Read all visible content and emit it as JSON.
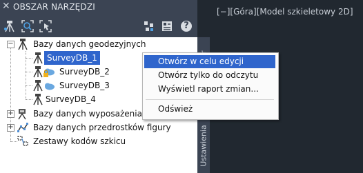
{
  "palette": {
    "title": "OBSZAR NARZĘDZI",
    "close_glyph": "✕"
  },
  "toolbar": {
    "left_icons": [
      "survey-network-icon",
      "zoom-extents-icon",
      "zoom-selection-icon"
    ],
    "right_icons": [
      "survey-preferences-icon",
      "properties-icon",
      "help-icon"
    ],
    "help_glyph": "?"
  },
  "tree": {
    "root": {
      "label": "Bazy danych geodezyjnych",
      "expander": "−"
    },
    "databases": [
      {
        "label": "SurveyDB_1",
        "selected": true,
        "locked": false
      },
      {
        "label": "SurveyDB_2",
        "selected": false,
        "locked": true
      },
      {
        "label": "SurveyDB_3",
        "selected": false,
        "locked": false
      },
      {
        "label": "SurveyDB_4",
        "selected": false,
        "locked": false
      }
    ],
    "others": [
      {
        "label": "Bazy danych wyposażenia",
        "expander": "+"
      },
      {
        "label": "Bazy danych przedrostków figury",
        "expander": "+"
      },
      {
        "label": "Zestawy kodów szkicu",
        "expander": ""
      }
    ]
  },
  "tabs": {
    "upper": "ator",
    "lower": "Ustawienia"
  },
  "viewport": {
    "label": "[−][Góra][Model szkieletowy 2D]"
  },
  "context_menu": {
    "items": [
      {
        "label": "Otwórz w celu edycji",
        "highlighted": true
      },
      {
        "label": "Otwórz tylko do odczytu",
        "highlighted": false
      },
      {
        "label": "Wyświetl raport zmian...",
        "highlighted": false
      },
      {
        "label": "Odśwież",
        "highlighted": false
      }
    ]
  },
  "colors": {
    "panel_bg": "#3b4453",
    "viewport_bg": "#212830",
    "selection": "#2f65cc",
    "tree_bg": "#ffffff"
  }
}
